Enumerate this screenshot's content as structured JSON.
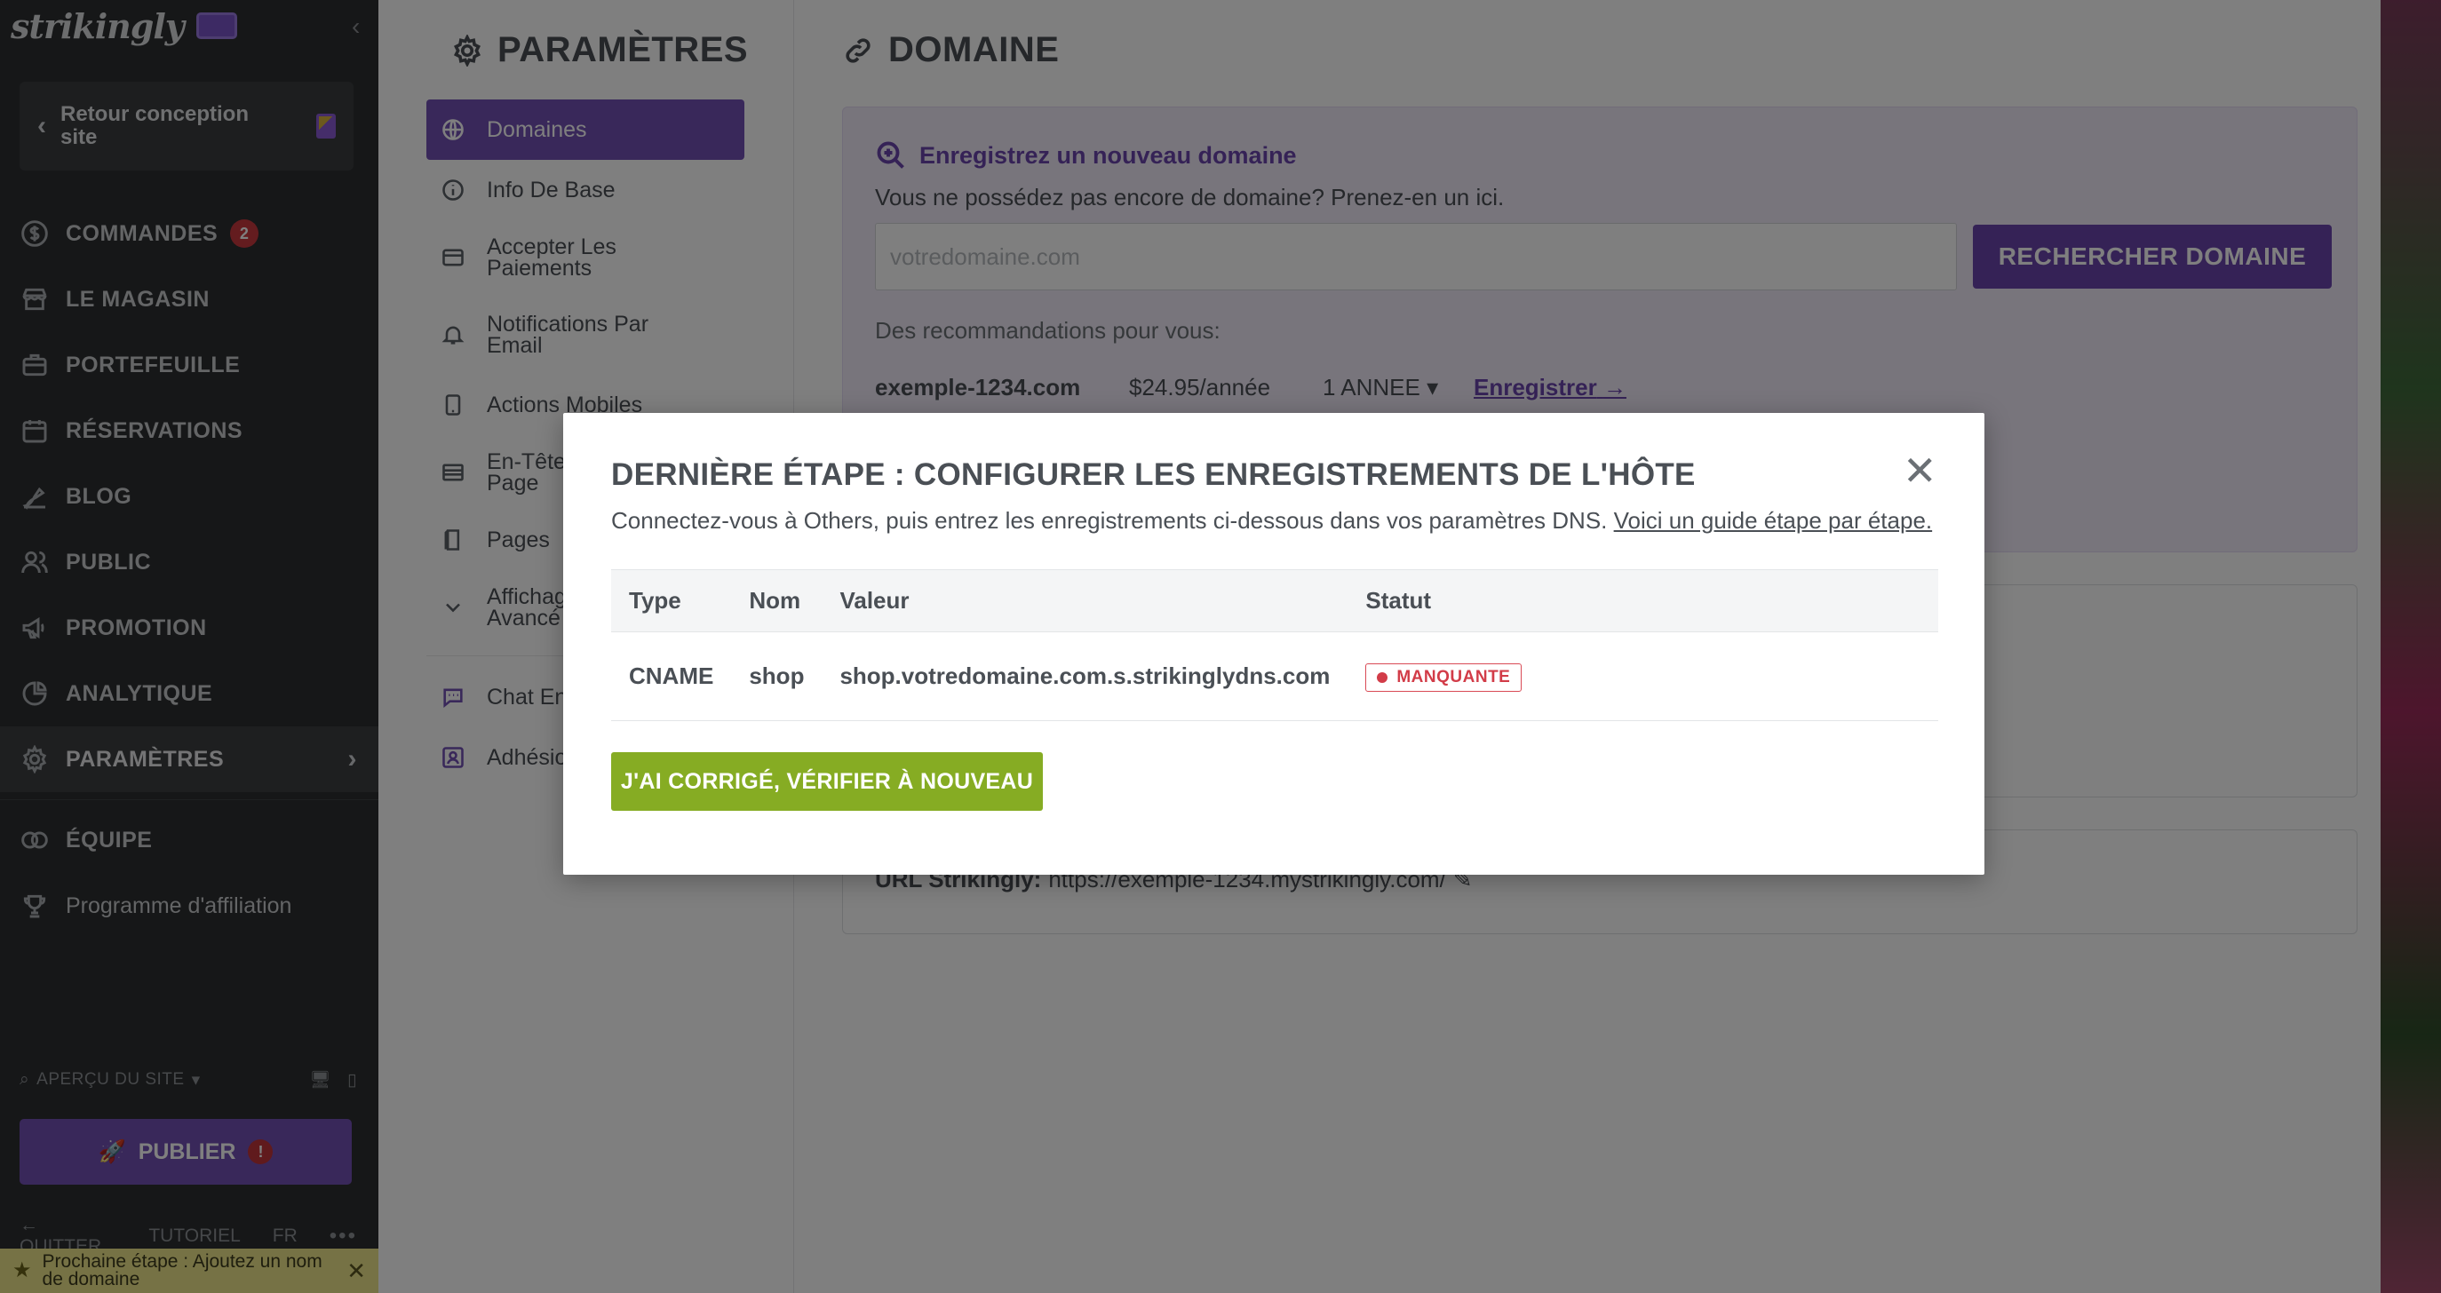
{
  "sidebar": {
    "logo": "strikingly",
    "collapse_icon": "chevron-left-icon",
    "back_label": "Retour conception site",
    "nav": [
      {
        "label": "COMMANDES",
        "icon": "dollar-circle-icon",
        "badge": "2"
      },
      {
        "label": "LE MAGASIN",
        "icon": "store-icon"
      },
      {
        "label": "PORTEFEUILLE",
        "icon": "briefcase-icon"
      },
      {
        "label": "RÉSERVATIONS",
        "icon": "calendar-icon"
      },
      {
        "label": "BLOG",
        "icon": "pen-icon"
      },
      {
        "label": "PUBLIC",
        "icon": "users-icon"
      },
      {
        "label": "PROMOTION",
        "icon": "megaphone-icon"
      },
      {
        "label": "ANALYTIQUE",
        "icon": "pie-chart-icon"
      },
      {
        "label": "PARAMÈTRES",
        "icon": "gear-icon",
        "active": true
      }
    ],
    "team_label": "ÉQUIPE",
    "affiliate_label": "Programme d'affiliation",
    "preview_label": "APERÇU DU SITE",
    "publish_label": "PUBLIER",
    "publish_warning": "!",
    "footer": {
      "quit": "QUITTER",
      "tutorial": "TUTORIEL",
      "lang": "FR",
      "more": "•••"
    },
    "next_step": "Prochaine étape : Ajoutez un nom de domaine"
  },
  "settings": {
    "title": "PARAMÈTRES",
    "items": [
      {
        "label": "Domaines",
        "icon": "globe-icon",
        "active": true
      },
      {
        "label": "Info De Base",
        "icon": "info-icon"
      },
      {
        "label": "Accepter Les Paiements",
        "icon": "card-icon"
      },
      {
        "label": "Notifications Par Email",
        "icon": "bell-icon"
      },
      {
        "label": "Actions Mobiles",
        "icon": "tablet-icon"
      },
      {
        "label": "En-Tête Page",
        "icon": "layout-icon"
      },
      {
        "label": "Pages",
        "icon": "page-icon"
      },
      {
        "label": "Affichage Avancé",
        "icon": "chevron-down-icon"
      },
      {
        "label": "Chat En Direct",
        "icon": "chat-icon"
      },
      {
        "label": "Adhésions",
        "icon": "member-icon"
      }
    ]
  },
  "main": {
    "title": "DOMAINE",
    "register_title": "Enregistrez un nouveau domaine",
    "register_sub": "Vous ne possédez pas encore de domaine? Prenez-en un ici.",
    "domain_placeholder": "votredomaine.com",
    "search_button": "RECHERCHER DOMAINE",
    "reco_label": "Des recommandations pour vous:",
    "reco": {
      "domain": "exemple-1234.com",
      "price": "$24.95/année",
      "years": "1 ANNEE",
      "register": "Enregistrer"
    },
    "url_label": "URL Strikingly:",
    "url_value": "https://exemple-1234.mystrikingly.com/"
  },
  "modal": {
    "title": "DERNIÈRE ÉTAPE : CONFIGURER LES ENREGISTREMENTS DE L'HÔTE",
    "desc": "Connectez-vous à Others, puis entrez les enregistrements ci-dessous dans vos paramètres DNS.",
    "guide_link": "Voici un guide étape par étape.",
    "table": {
      "headers": [
        "Type",
        "Nom",
        "Valeur",
        "Statut"
      ],
      "rows": [
        {
          "type": "CNAME",
          "name": "shop",
          "value": "shop.votredomaine.com.s.strikinglydns.com",
          "status": "MANQUANTE"
        }
      ]
    },
    "verify_button": "J'AI CORRIGÉ, VÉRIFIER À NOUVEAU"
  }
}
